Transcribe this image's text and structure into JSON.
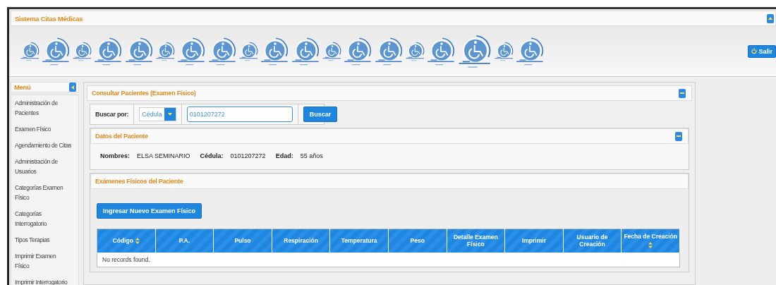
{
  "window": {
    "title": "Sistema Citas Médicas"
  },
  "header": {
    "logout_button": "Salir"
  },
  "sidebar": {
    "title": "Menú",
    "items": [
      {
        "label": "Administración de Pacientes"
      },
      {
        "label": "Examen Físico"
      },
      {
        "label": "Agendamiento de Citas"
      },
      {
        "label": "Administración de Usuarios"
      },
      {
        "label": "Categorías Examen Físico"
      },
      {
        "label": "Categorías Interrogatorio"
      },
      {
        "label": "Tipos Terapias"
      },
      {
        "label": "Imprimir Examen Físico"
      },
      {
        "label": "Imprimir Interrogatorio"
      }
    ]
  },
  "main_panel": {
    "title": "Consultar Pacientes (Examen Físico)",
    "search": {
      "label": "Buscar por:",
      "type_select": "Cédula",
      "value": "0101207272",
      "button": "Buscar"
    },
    "patient_panel": {
      "title": "Datos del Paciente",
      "fields": [
        {
          "label": "Nombres:",
          "value": "ELSA SEMINARIO"
        },
        {
          "label": "Cédula:",
          "value": "0101207272"
        },
        {
          "label": "Edad:",
          "value": "55 años"
        }
      ]
    },
    "exams_panel": {
      "title": "Exámenes Físicos del Paciente",
      "new_button": "Ingresar Nuevo Examen Físico",
      "table": {
        "columns": [
          {
            "label": "Código",
            "sortable": true
          },
          {
            "label": "P.A.",
            "sortable": false
          },
          {
            "label": "Pulso",
            "sortable": false
          },
          {
            "label": "Respiración",
            "sortable": false
          },
          {
            "label": "Temperatura",
            "sortable": false
          },
          {
            "label": "Peso",
            "sortable": false
          },
          {
            "label": "Detalle Examen Físico",
            "sortable": false
          },
          {
            "label": "Imprimir",
            "sortable": false
          },
          {
            "label": "Usuario de Creación",
            "sortable": false
          },
          {
            "label": "Fecha de Creación",
            "sortable": true
          }
        ],
        "empty_message": "No records found."
      }
    }
  }
}
